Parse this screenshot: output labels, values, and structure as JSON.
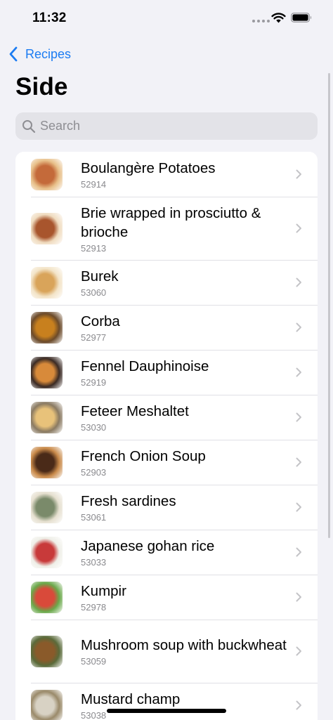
{
  "status_bar": {
    "time": "11:32"
  },
  "nav": {
    "back_label": "Recipes"
  },
  "page": {
    "title": "Side"
  },
  "search": {
    "placeholder": "Search",
    "value": ""
  },
  "recipes": [
    {
      "name": "Boulangère Potatoes",
      "id": "52914",
      "thumb_icon": "boulangere-potatoes-thumbnail",
      "colors": [
        "#c46a3a",
        "#e8c08a"
      ]
    },
    {
      "name": "Brie wrapped in prosciutto & brioche",
      "id": "52913",
      "thumb_icon": "brie-prosciutto-thumbnail",
      "colors": [
        "#a8552d",
        "#f0dcc0"
      ]
    },
    {
      "name": "Burek",
      "id": "53060",
      "thumb_icon": "burek-thumbnail",
      "colors": [
        "#d9a45a",
        "#f3e4c8"
      ]
    },
    {
      "name": "Corba",
      "id": "52977",
      "thumb_icon": "corba-thumbnail",
      "colors": [
        "#c8801e",
        "#6b4a2a"
      ]
    },
    {
      "name": "Fennel Dauphinoise",
      "id": "52919",
      "thumb_icon": "fennel-dauphinoise-thumbnail",
      "colors": [
        "#d88a3a",
        "#3a2a24"
      ]
    },
    {
      "name": "Feteer Meshaltet",
      "id": "53030",
      "thumb_icon": "feteer-meshaltet-thumbnail",
      "colors": [
        "#e8c27a",
        "#8a7a62"
      ]
    },
    {
      "name": "French Onion Soup",
      "id": "52903",
      "thumb_icon": "french-onion-soup-thumbnail",
      "colors": [
        "#4a2a18",
        "#c98a4a"
      ]
    },
    {
      "name": "Fresh sardines",
      "id": "53061",
      "thumb_icon": "fresh-sardines-thumbnail",
      "colors": [
        "#7a8a6a",
        "#e6e0d0"
      ]
    },
    {
      "name": "Japanese gohan rice",
      "id": "53033",
      "thumb_icon": "japanese-gohan-rice-thumbnail",
      "colors": [
        "#c83a3a",
        "#efefe8"
      ]
    },
    {
      "name": "Kumpir",
      "id": "52978",
      "thumb_icon": "kumpir-thumbnail",
      "colors": [
        "#d94a3a",
        "#6aa84a"
      ]
    },
    {
      "name": "Mushroom soup with buckwheat",
      "id": "53059",
      "thumb_icon": "mushroom-soup-thumbnail",
      "colors": [
        "#8a5a2a",
        "#5a6a3a"
      ]
    },
    {
      "name": "Mustard champ",
      "id": "53038",
      "thumb_icon": "mustard-champ-thumbnail",
      "colors": [
        "#d8d2c4",
        "#9a8a6a"
      ]
    }
  ],
  "theme": {
    "accent": "#1c7cf2",
    "background": "#f2f2f7",
    "card": "#ffffff",
    "secondary_text": "#8a8a8e"
  }
}
